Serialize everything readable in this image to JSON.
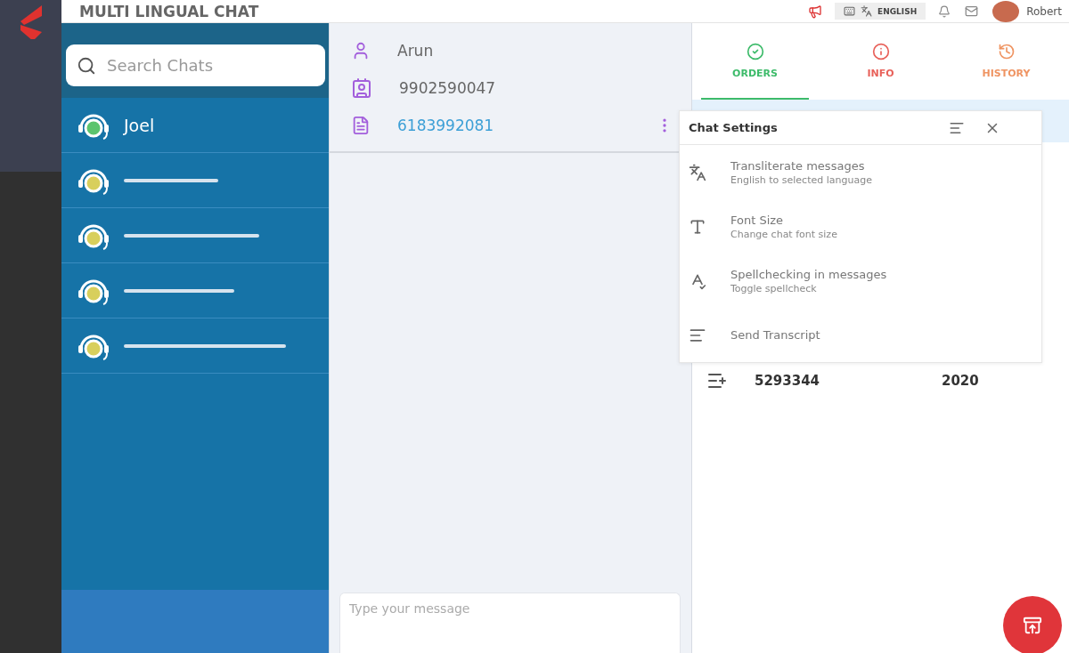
{
  "header": {
    "title": "MULTI LINGUAL CHAT",
    "language": "ENGLISH",
    "user": "Robert"
  },
  "search": {
    "placeholder": "Search Chats"
  },
  "chats": [
    {
      "kind": "named",
      "name": "Joel",
      "color": "#5cc46e"
    },
    {
      "kind": "loading",
      "color": "#d8cf5c"
    },
    {
      "kind": "loading",
      "color": "#d8cf5c"
    },
    {
      "kind": "loading",
      "color": "#d8cf5c"
    },
    {
      "kind": "loading",
      "color": "#d8cf5c"
    }
  ],
  "contact": {
    "name": "Arun",
    "phone": "9902590047",
    "ticket": "6183992081"
  },
  "composer": {
    "placeholder": "Type your message"
  },
  "tabs": [
    {
      "label": "ORDERS",
      "selected": true,
      "color": "#3dbb6a"
    },
    {
      "label": "INFO",
      "selected": false,
      "color": "#e8615a"
    },
    {
      "label": "HISTORY",
      "selected": false,
      "color": "#ef9462"
    }
  ],
  "orders": [
    {
      "number": "5293344",
      "year": "2020"
    }
  ],
  "settings": {
    "title": "Chat Settings",
    "items": [
      {
        "kind": "translate",
        "title": "Transliterate messages",
        "subtitle": "English to selected language"
      },
      {
        "kind": "fontsize",
        "title": "Font Size",
        "subtitle": "Change chat font size"
      },
      {
        "kind": "spellcheck",
        "title": "Spellchecking in messages",
        "subtitle": "Toggle spellcheck"
      },
      {
        "kind": "transcript",
        "title": "Send Transcript"
      }
    ]
  }
}
